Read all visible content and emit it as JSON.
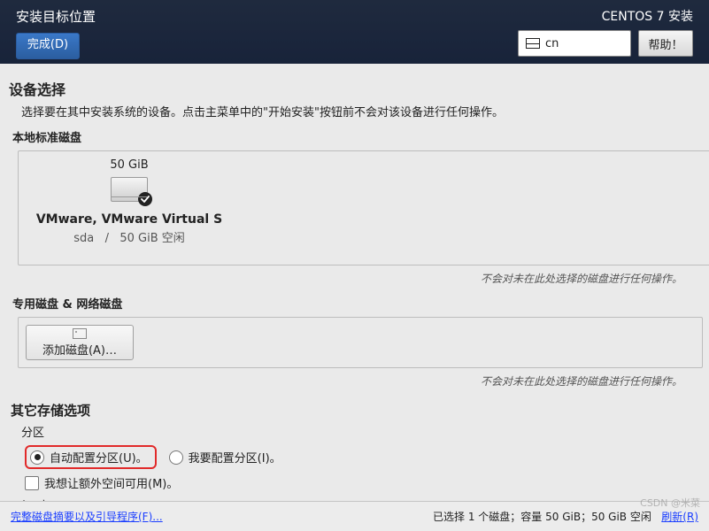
{
  "header": {
    "title": "安装目标位置",
    "done_label": "完成(D)",
    "product": "CENTOS 7 安装",
    "language": "cn",
    "help_label": "帮助！"
  },
  "device_selection": {
    "heading": "设备选择",
    "description": "选择要在其中安装系统的设备。点击主菜单中的\"开始安装\"按钮前不会对该设备进行任何操作。"
  },
  "local_disks": {
    "heading": "本地标准磁盘",
    "disk": {
      "size": "50 GiB",
      "name": "VMware, VMware Virtual S",
      "sub": "sda   /   50 GiB 空闲",
      "selected": true
    },
    "note": "不会对未在此处选择的磁盘进行任何操作。"
  },
  "network_disks": {
    "heading": "专用磁盘 & 网络磁盘",
    "add_label": "添加磁盘(A)…",
    "note": "不会对未在此处选择的磁盘进行任何操作。"
  },
  "other_storage": {
    "heading": "其它存储选项",
    "partition_label": "分区",
    "auto_label": "自动配置分区(U)。",
    "manual_label": "我要配置分区(I)。",
    "extra_space_label": "我想让额外空间可用(M)。",
    "encryption_label": "加密"
  },
  "footer": {
    "summary_link": "完整磁盘摘要以及引导程序(F)...",
    "status": "已选择 1 个磁盘；容量 50 GiB；50 GiB 空闲",
    "refresh_link": "刷新(R)"
  },
  "watermark": "CSDN @米菜"
}
